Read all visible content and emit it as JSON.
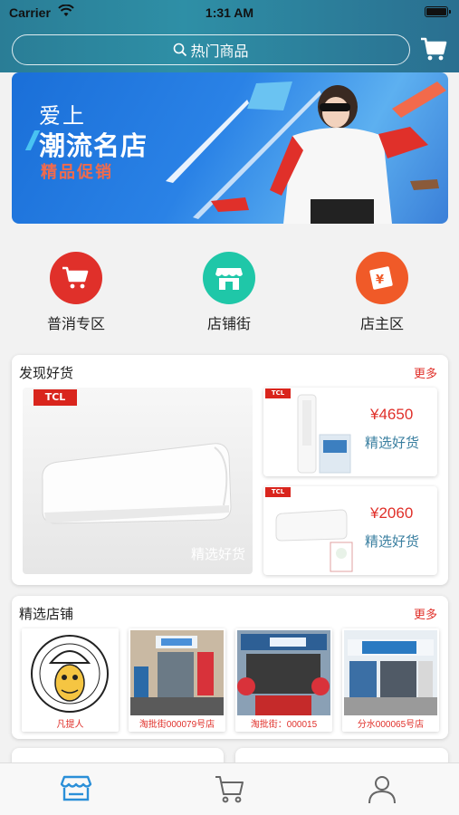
{
  "status_bar": {
    "carrier": "Carrier",
    "time": "1:31 AM"
  },
  "search": {
    "placeholder": "热门商品"
  },
  "banner": {
    "line1": "爱上",
    "line2": "潮流名店",
    "line3": "精品促销"
  },
  "categories": [
    {
      "label": "普消专区",
      "icon": "cart-icon",
      "color": "#e0302a"
    },
    {
      "label": "店铺街",
      "icon": "store-icon",
      "color": "#1fc7a8"
    },
    {
      "label": "店主区",
      "icon": "shop-owner-icon",
      "color": "#f05a28"
    }
  ],
  "discover": {
    "title": "发现好货",
    "more": "更多",
    "featured": {
      "badge": "TCL",
      "caption": "精选好货"
    },
    "items": [
      {
        "badge": "TCL",
        "price": "¥4650",
        "caption": "精选好货"
      },
      {
        "badge": "TCL",
        "price": "¥2060",
        "caption": "精选好货"
      }
    ]
  },
  "shops": {
    "title": "精选店铺",
    "more": "更多",
    "items": [
      {
        "name": "凡提人"
      },
      {
        "name": "淘批街000079号店"
      },
      {
        "name": "淘批街：000015"
      },
      {
        "name": "分水000065号店"
      }
    ]
  },
  "tabbar": {
    "active": "home",
    "accent": "#2a8fd8"
  }
}
